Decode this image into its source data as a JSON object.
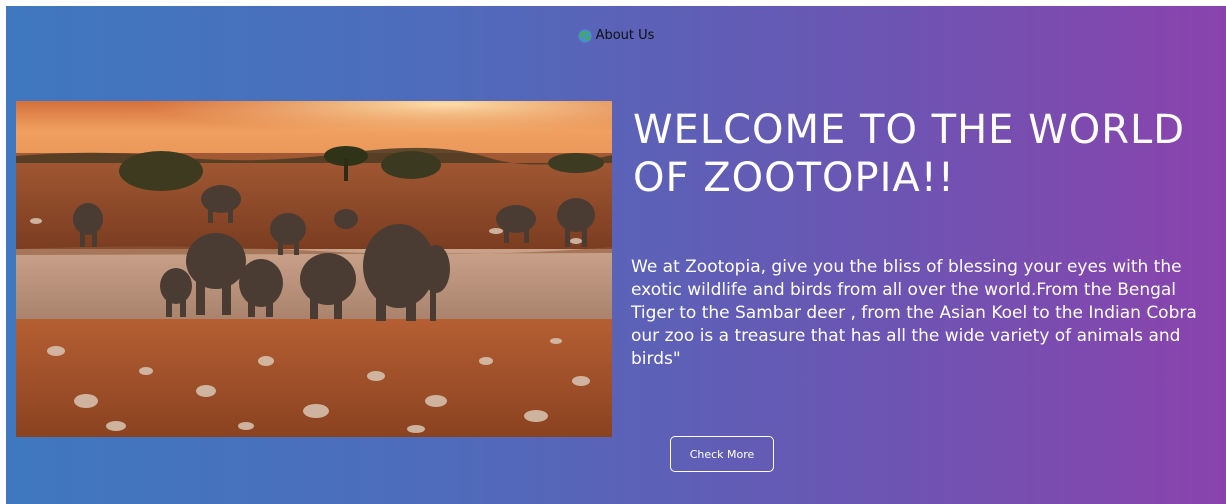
{
  "nav": {
    "about_label": "About Us",
    "about_icon": "globe-icon"
  },
  "hero": {
    "image_subject": "elephants-at-waterhole-image",
    "headline": "WELCOME TO THE WORLD OF ZOOTOPIA!!",
    "description": "We at Zootopia, give you the bliss of blessing your eyes with the exotic wildlife and birds from all over the world.From the Bengal Tiger to the Sambar deer , from the Asian Koel to the Indian Cobra our zoo is a treasure that has all the wide variety of animals and birds\"",
    "cta_label": "Check More"
  },
  "colors": {
    "gradient_start": "#3f78bf",
    "gradient_end": "#8a43ad",
    "text": "#ffffff"
  }
}
